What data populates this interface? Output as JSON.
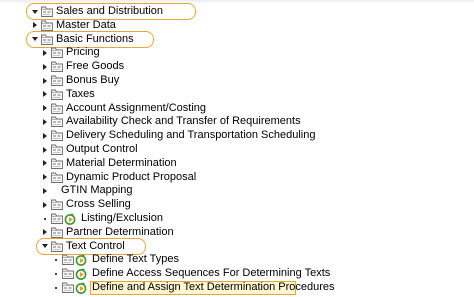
{
  "tree": [
    {
      "label": "Sales and Distribution",
      "level": 0,
      "state": "expanded",
      "icons": [
        "folder"
      ],
      "circled": true
    },
    {
      "label": "Master Data",
      "level": 1,
      "state": "collapsed",
      "icons": [
        "folder"
      ]
    },
    {
      "label": "Basic Functions",
      "level": 1,
      "state": "expanded",
      "icons": [
        "folder"
      ],
      "circled": true
    },
    {
      "label": "Pricing",
      "level": 2,
      "state": "collapsed",
      "icons": [
        "folder"
      ]
    },
    {
      "label": "Free Goods",
      "level": 2,
      "state": "collapsed",
      "icons": [
        "folder"
      ]
    },
    {
      "label": "Bonus Buy",
      "level": 2,
      "state": "collapsed",
      "icons": [
        "folder"
      ]
    },
    {
      "label": "Taxes",
      "level": 2,
      "state": "collapsed",
      "icons": [
        "folder"
      ]
    },
    {
      "label": "Account Assignment/Costing",
      "level": 2,
      "state": "collapsed",
      "icons": [
        "folder"
      ]
    },
    {
      "label": "Availability Check and Transfer of Requirements",
      "level": 2,
      "state": "collapsed",
      "icons": [
        "folder"
      ]
    },
    {
      "label": "Delivery Scheduling and Transportation Scheduling",
      "level": 2,
      "state": "collapsed",
      "icons": [
        "folder"
      ]
    },
    {
      "label": "Output Control",
      "level": 2,
      "state": "collapsed",
      "icons": [
        "folder"
      ]
    },
    {
      "label": "Material Determination",
      "level": 2,
      "state": "collapsed",
      "icons": [
        "folder"
      ]
    },
    {
      "label": "Dynamic Product Proposal",
      "level": 2,
      "state": "collapsed",
      "icons": [
        "folder"
      ]
    },
    {
      "label": "GTIN Mapping",
      "level": 2,
      "state": "collapsed",
      "icons": []
    },
    {
      "label": "Cross Selling",
      "level": 2,
      "state": "collapsed",
      "icons": [
        "folder"
      ]
    },
    {
      "label": "Listing/Exclusion",
      "level": 2,
      "state": "leaf",
      "icons": [
        "folder",
        "execute"
      ]
    },
    {
      "label": "Partner Determination",
      "level": 2,
      "state": "collapsed",
      "icons": [
        "folder"
      ]
    },
    {
      "label": "Text Control",
      "level": 2,
      "state": "expanded",
      "icons": [
        "folder"
      ],
      "circled": true
    },
    {
      "label": "Define Text Types",
      "level": 3,
      "state": "leaf",
      "icons": [
        "folder",
        "execute"
      ]
    },
    {
      "label": "Define Access Sequences For Determining Texts",
      "level": 3,
      "state": "leaf",
      "icons": [
        "folder",
        "execute"
      ]
    },
    {
      "label": "Define and Assign Text Determination Procedures",
      "level": 3,
      "state": "leaf",
      "icons": [
        "folder",
        "execute"
      ],
      "highlighted": true
    }
  ],
  "colors": {
    "annotation_orange": "#e8a63a",
    "highlight_fill": "#fff8d0",
    "execute_green": "#3a9a2e",
    "execute_orange": "#e89a1c"
  }
}
